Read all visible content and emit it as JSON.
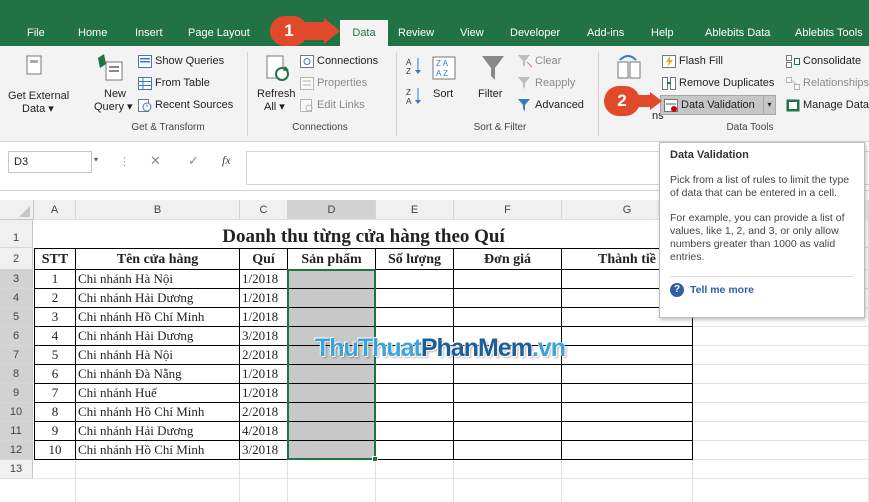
{
  "ribbon_tabs": [
    {
      "label": "File"
    },
    {
      "label": "Home"
    },
    {
      "label": "Insert"
    },
    {
      "label": "Page Layout"
    },
    {
      "label": "Data"
    },
    {
      "label": "Review"
    },
    {
      "label": "View"
    },
    {
      "label": "Developer"
    },
    {
      "label": "Add-ins"
    },
    {
      "label": "Help"
    },
    {
      "label": "Ablebits Data"
    },
    {
      "label": "Ablebits Tools"
    }
  ],
  "active_tab": "Data",
  "callouts": {
    "one": "1",
    "two": "2"
  },
  "groups": {
    "get_transform": {
      "label": "Get & Transform",
      "get_external_l1": "Get External",
      "get_external_l2": "Data ▾",
      "new_query_l1": "New",
      "new_query_l2": "Query ▾",
      "show_queries": "Show Queries",
      "from_table": "From Table",
      "recent_sources": "Recent Sources"
    },
    "connections": {
      "label": "Connections",
      "refresh_l1": "Refresh",
      "refresh_l2": "All ▾",
      "connections": "Connections",
      "properties": "Properties",
      "edit_links": "Edit Links"
    },
    "sort_filter": {
      "label": "Sort & Filter",
      "sort": "Sort",
      "filter": "Filter",
      "clear": "Clear",
      "reapply": "Reapply",
      "advanced": "Advanced"
    },
    "data_tools": {
      "label": "Data Tools",
      "flash_fill": "Flash Fill",
      "remove_duplicates": "Remove Duplicates",
      "data_validation": "Data Validation",
      "consolidate": "Consolidate",
      "relationships": "Relationships",
      "manage_data": "Manage Data",
      "partial": "ns"
    }
  },
  "formula_bar": {
    "name_box": "D3",
    "fx": "fx",
    "cancel": "✕",
    "confirm": "✓"
  },
  "tooltip": {
    "title": "Data Validation",
    "body1": "Pick from a list of rules to limit the type of data that can be entered in a cell.",
    "body2": "For example, you can provide a list of values, like 1, 2, and 3, or only allow numbers greater than 1000 as valid entries.",
    "link": "Tell me more"
  },
  "sheet": {
    "columns": [
      "A",
      "B",
      "C",
      "D",
      "E",
      "F",
      "G"
    ],
    "rows": [
      "1",
      "2",
      "3",
      "4",
      "5",
      "6",
      "7",
      "8",
      "9",
      "10",
      "11",
      "12",
      "13"
    ],
    "title": "Doanh thu từng cửa hàng theo Quí",
    "headers": {
      "stt": "STT",
      "store": "Tên cửa hàng",
      "quarter": "Quí",
      "product": "Sản phẩm",
      "qty": "Số lượng",
      "price": "Đơn giá",
      "total": "Thành tiề"
    },
    "data": [
      {
        "stt": "1",
        "store": "Chi nhánh Hà Nội",
        "quarter": "1/2018"
      },
      {
        "stt": "2",
        "store": "Chi nhánh Hải Dương",
        "quarter": "1/2018"
      },
      {
        "stt": "3",
        "store": "Chi nhánh Hồ Chí Minh",
        "quarter": "1/2018"
      },
      {
        "stt": "4",
        "store": "Chi nhánh Hải Dương",
        "quarter": "3/2018"
      },
      {
        "stt": "5",
        "store": "Chi nhánh Hà Nội",
        "quarter": "2/2018"
      },
      {
        "stt": "6",
        "store": "Chi nhánh Đà Nẵng",
        "quarter": "1/2018"
      },
      {
        "stt": "7",
        "store": "Chi nhánh Huế",
        "quarter": "1/2018"
      },
      {
        "stt": "8",
        "store": "Chi nhánh Hồ Chí Minh",
        "quarter": "2/2018"
      },
      {
        "stt": "9",
        "store": "Chi nhánh Hải Dương",
        "quarter": "4/2018"
      },
      {
        "stt": "10",
        "store": "Chi nhánh Hồ Chí Minh",
        "quarter": "3/2018"
      }
    ]
  },
  "watermark": {
    "part1": "ThuThuat",
    "part2": "PhanMem",
    "part3": ".vn"
  },
  "colors": {
    "excel_green": "#217346",
    "callout_red": "#e04a2a",
    "selection_gray": "#c8c8c8"
  }
}
